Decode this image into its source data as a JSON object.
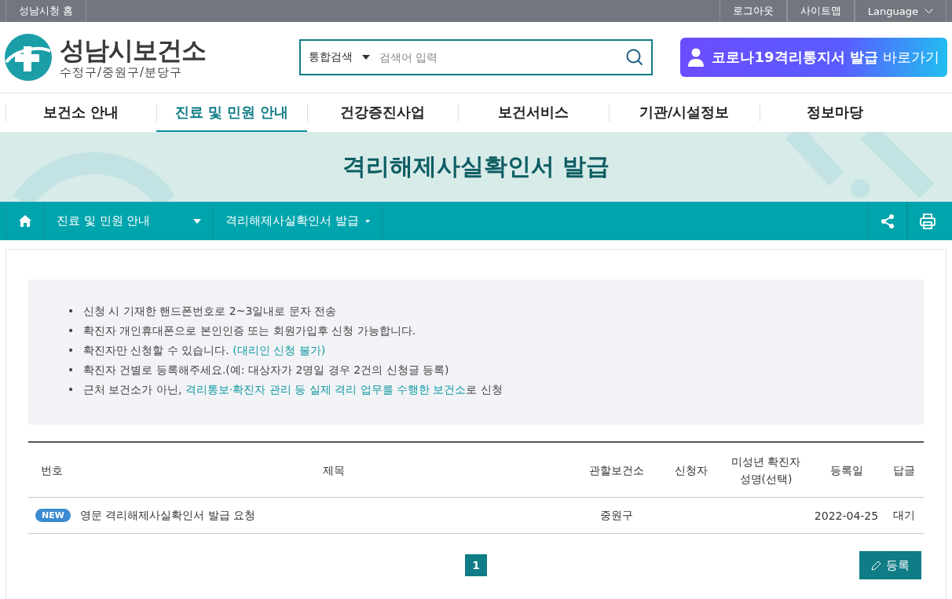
{
  "top_bar": {
    "left_links": [
      "성남시청 홈"
    ],
    "right_links": [
      "로그아웃",
      "사이트맵"
    ],
    "language": "Language"
  },
  "header": {
    "site_title": "성남시보건소",
    "site_subtitle": "수정구/중원구/분당구",
    "search": {
      "scope": "통합검색",
      "placeholder": "검색어 입력"
    },
    "promo_button": {
      "bold": "코로나19격리통지서 발급",
      "rest": "바로가기"
    }
  },
  "nav": [
    {
      "label": "보건소 안내",
      "selected": false
    },
    {
      "label": "진료 및 민원 안내",
      "selected": true
    },
    {
      "label": "건강증진사업",
      "selected": false
    },
    {
      "label": "보건서비스",
      "selected": false
    },
    {
      "label": "기관/시설정보",
      "selected": false
    },
    {
      "label": "정보마당",
      "selected": false
    }
  ],
  "page_title": "격리해제사실확인서 발급",
  "breadcrumb": [
    "진료 및 민원 안내",
    "격리해제사실확인서 발급"
  ],
  "notices": [
    {
      "bullet": "•",
      "parts": [
        {
          "kind": "text",
          "text": "신청 시 기재한 핸드폰번호로 2~3일내로 문자 전송"
        }
      ]
    },
    {
      "bullet": "•",
      "parts": [
        {
          "kind": "text",
          "text": "확진자 개인휴대폰으로 본인인증 또는 회원가입후 신청 가능합니다."
        }
      ]
    },
    {
      "bullet": "•",
      "parts": [
        {
          "kind": "text",
          "text": "확진자만 신청할 수 있습니다. "
        },
        {
          "kind": "link",
          "text": "(대리인 신청 불가)"
        }
      ]
    },
    {
      "bullet": "•",
      "parts": [
        {
          "kind": "text",
          "text": "확진자 건별로 등록해주세요.(예: 대상자가 2명일 경우 2건의 신청글 등록)"
        }
      ]
    },
    {
      "bullet": "•",
      "parts": [
        {
          "kind": "text",
          "text": "근처 보건소가 아닌, "
        },
        {
          "kind": "link",
          "text": "격리통보·확진자 관리 등 실제 격리 업무를 수행한 보건소"
        },
        {
          "kind": "text",
          "text": "로 신청"
        }
      ]
    }
  ],
  "table": {
    "columns": [
      "번호",
      "제목",
      "관할보건소",
      "신청자",
      "미성년 확진자\n성명(선택)",
      "등록일",
      "답글"
    ],
    "rows": [
      {
        "badge": "NEW",
        "title": "영문 격리해제사실확인서 발급 요청",
        "center": "중원구",
        "date": "2022-04-25",
        "reply": "대기"
      }
    ]
  },
  "pagination": [
    {
      "label": "1",
      "selected": true
    }
  ],
  "register_button": "등록"
}
